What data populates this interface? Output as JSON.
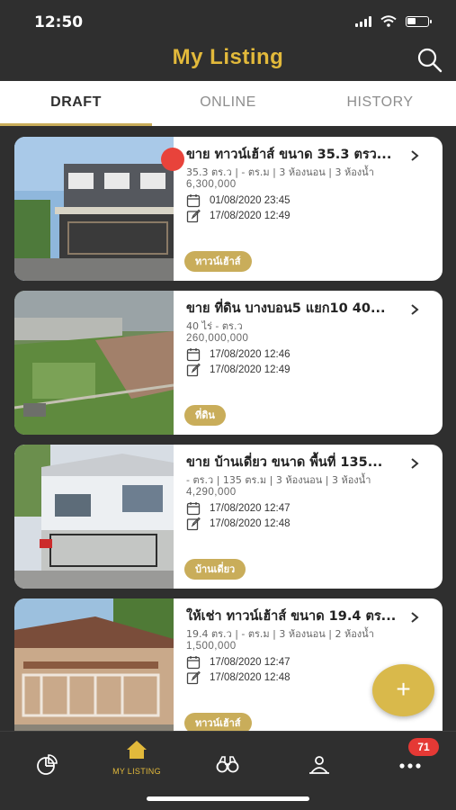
{
  "status_bar": {
    "time": "12:50"
  },
  "header": {
    "title": "My Listing"
  },
  "tabs": [
    {
      "label": "DRAFT",
      "active": true
    },
    {
      "label": "ONLINE",
      "active": false
    },
    {
      "label": "HISTORY",
      "active": false
    }
  ],
  "listings": [
    {
      "title": "ขาย ทาวน์เฮ้าส์ ขนาด 35.3 ตรว...",
      "specs": "35.3 ตร.ว | - ตร.ม | 3 ห้องนอน | 3 ห้องน้ำ",
      "price": "6,300,000",
      "created": "01/08/2020 23:45",
      "edited": "17/08/2020 12:49",
      "type": "ทาวน์เฮ้าส์",
      "photo": "townhouse-photo"
    },
    {
      "title": "ขาย  ที่ดิน บางบอน5 แยก10 40...",
      "specs": "40 ไร่ - ตร.ว",
      "price": "260,000,000",
      "created": "17/08/2020 12:46",
      "edited": "17/08/2020 12:49",
      "type": "ที่ดิน",
      "photo": "land-photo"
    },
    {
      "title": "ขาย บ้านเดี่ยว ขนาด พื้นที่ 135...",
      "specs": "- ตร.ว | 135 ตร.ม | 3 ห้องนอน | 3 ห้องน้ำ",
      "price": "4,290,000",
      "created": "17/08/2020 12:47",
      "edited": "17/08/2020 12:48",
      "type": "บ้านเดี่ยว",
      "photo": "house-photo"
    },
    {
      "title": "ให้เช่า ทาวน์เฮ้าส์ ขนาด 19.4 ตร...",
      "specs": "19.4 ตร.ว | - ตร.ม | 3 ห้องนอน | 2 ห้องน้ำ",
      "price": "1,500,000",
      "created": "17/08/2020 12:47",
      "edited": "17/08/2020 12:48",
      "type": "ทาวน์เฮ้าส์",
      "photo": "townhouse-photo"
    }
  ],
  "fab": {
    "icon": "plus-icon",
    "symbol": "+"
  },
  "bottom_nav": {
    "items": [
      {
        "icon": "pie-chart-icon"
      },
      {
        "icon": "home-icon",
        "label": "MY LISTING",
        "active": true
      },
      {
        "icon": "binoculars-icon"
      },
      {
        "icon": "agent-icon"
      },
      {
        "icon": "more-icon"
      }
    ],
    "badge": "71"
  },
  "colors": {
    "accent": "#c9ad5a",
    "title_gold": "#e2b93b",
    "background": "#2f2f2f",
    "badge": "#e53935"
  }
}
